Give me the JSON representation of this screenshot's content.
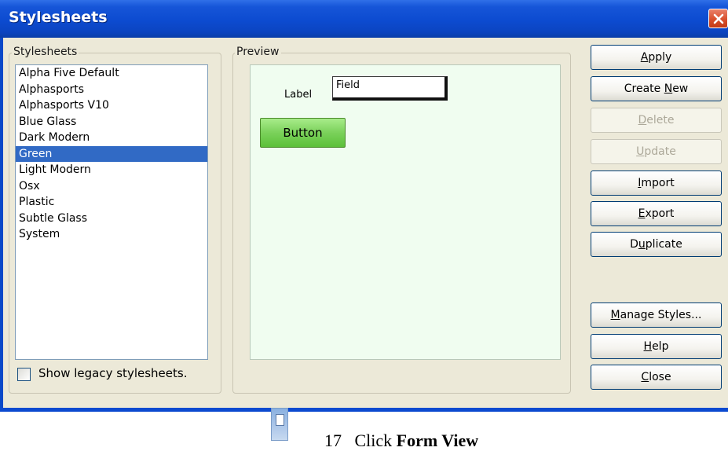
{
  "window": {
    "title": "Stylesheets",
    "close_icon": "close-icon"
  },
  "stylesheets_group": {
    "label": "Stylesheets",
    "items": [
      "Alpha Five Default",
      "Alphasports",
      "Alphasports V10",
      "Blue Glass",
      "Dark Modern",
      "Green",
      "Light Modern",
      "Osx",
      "Plastic",
      "Subtle Glass",
      "System"
    ],
    "selected": "Green",
    "legacy_checkbox_label": "Show legacy stylesheets.",
    "legacy_checked": false
  },
  "preview_group": {
    "label": "Preview",
    "sample_label": "Label",
    "sample_field": "Field",
    "sample_button": "Button"
  },
  "buttons": {
    "apply": {
      "pre": "",
      "u": "A",
      "post": "pply"
    },
    "create_new": {
      "pre": "Create ",
      "u": "N",
      "post": "ew"
    },
    "delete": {
      "pre": "",
      "u": "D",
      "post": "elete",
      "disabled": true
    },
    "update": {
      "pre": "",
      "u": "U",
      "post": "pdate",
      "disabled": true
    },
    "import": {
      "pre": "",
      "u": "I",
      "post": "mport"
    },
    "export": {
      "pre": "",
      "u": "E",
      "post": "xport"
    },
    "duplicate": {
      "pre": "D",
      "u": "u",
      "post": "plicate"
    },
    "manage_styles": {
      "pre": "",
      "u": "M",
      "post": "anage Styles..."
    },
    "help": {
      "pre": "",
      "u": "H",
      "post": "elp"
    },
    "close": {
      "pre": "",
      "u": "C",
      "post": "lose"
    }
  },
  "below": {
    "step_number": "17",
    "step_text": "Click",
    "step_bold": "Form View",
    "icon": "form-view-icon"
  },
  "colors": {
    "titlebar": "#0c4bd0",
    "selection": "#316ac5",
    "preview_bg": "#f0fdf0",
    "preview_button": "#7ad15a"
  }
}
